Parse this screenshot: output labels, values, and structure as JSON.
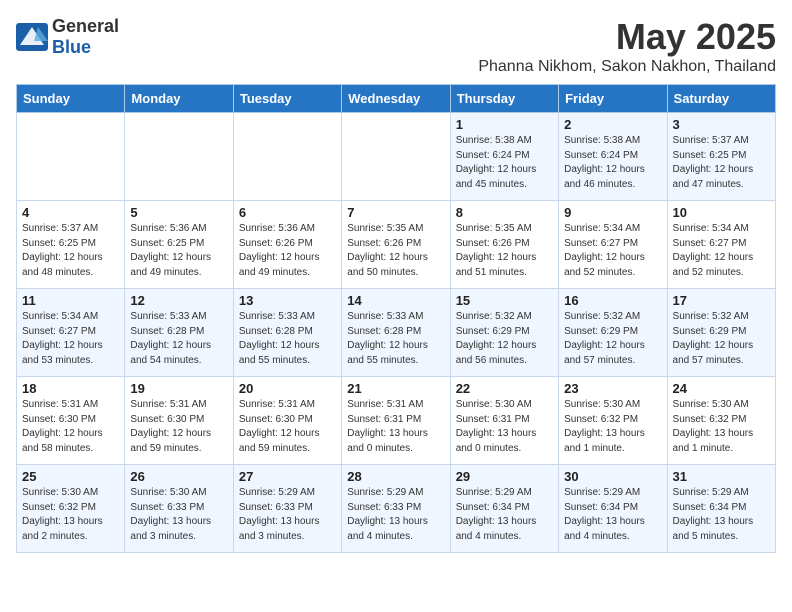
{
  "header": {
    "logo_general": "General",
    "logo_blue": "Blue",
    "title": "May 2025",
    "subtitle": "Phanna Nikhom, Sakon Nakhon, Thailand"
  },
  "days_of_week": [
    "Sunday",
    "Monday",
    "Tuesday",
    "Wednesday",
    "Thursday",
    "Friday",
    "Saturday"
  ],
  "weeks": [
    [
      {
        "day": "",
        "info": ""
      },
      {
        "day": "",
        "info": ""
      },
      {
        "day": "",
        "info": ""
      },
      {
        "day": "",
        "info": ""
      },
      {
        "day": "1",
        "info": "Sunrise: 5:38 AM\nSunset: 6:24 PM\nDaylight: 12 hours\nand 45 minutes."
      },
      {
        "day": "2",
        "info": "Sunrise: 5:38 AM\nSunset: 6:24 PM\nDaylight: 12 hours\nand 46 minutes."
      },
      {
        "day": "3",
        "info": "Sunrise: 5:37 AM\nSunset: 6:25 PM\nDaylight: 12 hours\nand 47 minutes."
      }
    ],
    [
      {
        "day": "4",
        "info": "Sunrise: 5:37 AM\nSunset: 6:25 PM\nDaylight: 12 hours\nand 48 minutes."
      },
      {
        "day": "5",
        "info": "Sunrise: 5:36 AM\nSunset: 6:25 PM\nDaylight: 12 hours\nand 49 minutes."
      },
      {
        "day": "6",
        "info": "Sunrise: 5:36 AM\nSunset: 6:26 PM\nDaylight: 12 hours\nand 49 minutes."
      },
      {
        "day": "7",
        "info": "Sunrise: 5:35 AM\nSunset: 6:26 PM\nDaylight: 12 hours\nand 50 minutes."
      },
      {
        "day": "8",
        "info": "Sunrise: 5:35 AM\nSunset: 6:26 PM\nDaylight: 12 hours\nand 51 minutes."
      },
      {
        "day": "9",
        "info": "Sunrise: 5:34 AM\nSunset: 6:27 PM\nDaylight: 12 hours\nand 52 minutes."
      },
      {
        "day": "10",
        "info": "Sunrise: 5:34 AM\nSunset: 6:27 PM\nDaylight: 12 hours\nand 52 minutes."
      }
    ],
    [
      {
        "day": "11",
        "info": "Sunrise: 5:34 AM\nSunset: 6:27 PM\nDaylight: 12 hours\nand 53 minutes."
      },
      {
        "day": "12",
        "info": "Sunrise: 5:33 AM\nSunset: 6:28 PM\nDaylight: 12 hours\nand 54 minutes."
      },
      {
        "day": "13",
        "info": "Sunrise: 5:33 AM\nSunset: 6:28 PM\nDaylight: 12 hours\nand 55 minutes."
      },
      {
        "day": "14",
        "info": "Sunrise: 5:33 AM\nSunset: 6:28 PM\nDaylight: 12 hours\nand 55 minutes."
      },
      {
        "day": "15",
        "info": "Sunrise: 5:32 AM\nSunset: 6:29 PM\nDaylight: 12 hours\nand 56 minutes."
      },
      {
        "day": "16",
        "info": "Sunrise: 5:32 AM\nSunset: 6:29 PM\nDaylight: 12 hours\nand 57 minutes."
      },
      {
        "day": "17",
        "info": "Sunrise: 5:32 AM\nSunset: 6:29 PM\nDaylight: 12 hours\nand 57 minutes."
      }
    ],
    [
      {
        "day": "18",
        "info": "Sunrise: 5:31 AM\nSunset: 6:30 PM\nDaylight: 12 hours\nand 58 minutes."
      },
      {
        "day": "19",
        "info": "Sunrise: 5:31 AM\nSunset: 6:30 PM\nDaylight: 12 hours\nand 59 minutes."
      },
      {
        "day": "20",
        "info": "Sunrise: 5:31 AM\nSunset: 6:30 PM\nDaylight: 12 hours\nand 59 minutes."
      },
      {
        "day": "21",
        "info": "Sunrise: 5:31 AM\nSunset: 6:31 PM\nDaylight: 13 hours\nand 0 minutes."
      },
      {
        "day": "22",
        "info": "Sunrise: 5:30 AM\nSunset: 6:31 PM\nDaylight: 13 hours\nand 0 minutes."
      },
      {
        "day": "23",
        "info": "Sunrise: 5:30 AM\nSunset: 6:32 PM\nDaylight: 13 hours\nand 1 minute."
      },
      {
        "day": "24",
        "info": "Sunrise: 5:30 AM\nSunset: 6:32 PM\nDaylight: 13 hours\nand 1 minute."
      }
    ],
    [
      {
        "day": "25",
        "info": "Sunrise: 5:30 AM\nSunset: 6:32 PM\nDaylight: 13 hours\nand 2 minutes."
      },
      {
        "day": "26",
        "info": "Sunrise: 5:30 AM\nSunset: 6:33 PM\nDaylight: 13 hours\nand 3 minutes."
      },
      {
        "day": "27",
        "info": "Sunrise: 5:29 AM\nSunset: 6:33 PM\nDaylight: 13 hours\nand 3 minutes."
      },
      {
        "day": "28",
        "info": "Sunrise: 5:29 AM\nSunset: 6:33 PM\nDaylight: 13 hours\nand 4 minutes."
      },
      {
        "day": "29",
        "info": "Sunrise: 5:29 AM\nSunset: 6:34 PM\nDaylight: 13 hours\nand 4 minutes."
      },
      {
        "day": "30",
        "info": "Sunrise: 5:29 AM\nSunset: 6:34 PM\nDaylight: 13 hours\nand 4 minutes."
      },
      {
        "day": "31",
        "info": "Sunrise: 5:29 AM\nSunset: 6:34 PM\nDaylight: 13 hours\nand 5 minutes."
      }
    ]
  ]
}
